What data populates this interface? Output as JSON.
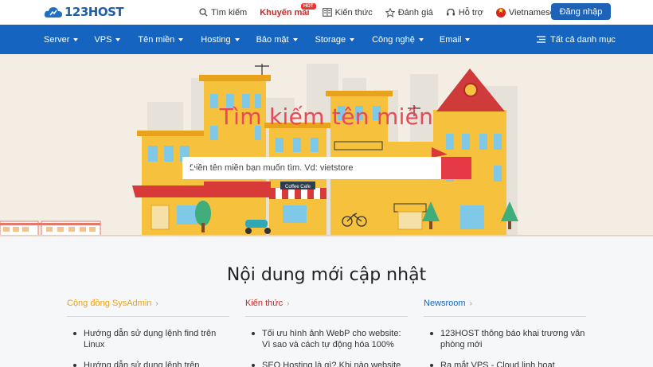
{
  "brand": {
    "logo_text": "123HOST"
  },
  "topnav": {
    "search": "Tìm kiếm",
    "promo": "Khuyến mãi",
    "promo_badge": "HOT",
    "knowledge": "Kiến thức",
    "review": "Đánh giá",
    "support": "Hỗ trợ",
    "language": "Vietnamese",
    "login": "Đăng nhập"
  },
  "menu": {
    "items": [
      "Server",
      "VPS",
      "Tên miền",
      "Hosting",
      "Bảo mật",
      "Storage",
      "Công nghệ",
      "Email"
    ],
    "all_categories": "Tất cả danh mục"
  },
  "hero": {
    "title": "Tìm kiếm tên miền",
    "search_placeholder": "Điền tên miền bạn muốn tìm. Vd: vietstore",
    "signs": {
      "cafe": "Coffee Cafe"
    }
  },
  "content": {
    "title": "Nội dung mới cập nhật",
    "columns": [
      {
        "heading": "Cộng đồng SysAdmin",
        "color": "#e8a317",
        "items": [
          "Hướng dẫn sử dụng lệnh find trên Linux",
          "Hướng dẫn sử dụng lệnh trên"
        ]
      },
      {
        "heading": "Kiến thức",
        "color": "#c62828",
        "items": [
          "Tối ưu hình ảnh WebP cho website: Vì sao và cách tự động hóa 100%",
          "SEO Hosting là gì? Khi nào website"
        ]
      },
      {
        "heading": "Newsroom",
        "color": "#1565c0",
        "items": [
          "123HOST thông báo khai trương văn phòng mới",
          "Ra mắt VPS - Cloud linh hoạt"
        ]
      }
    ]
  },
  "colors": {
    "primary": "#1565c0",
    "accent": "#e53945",
    "hero_bg": "#f3ede4"
  }
}
